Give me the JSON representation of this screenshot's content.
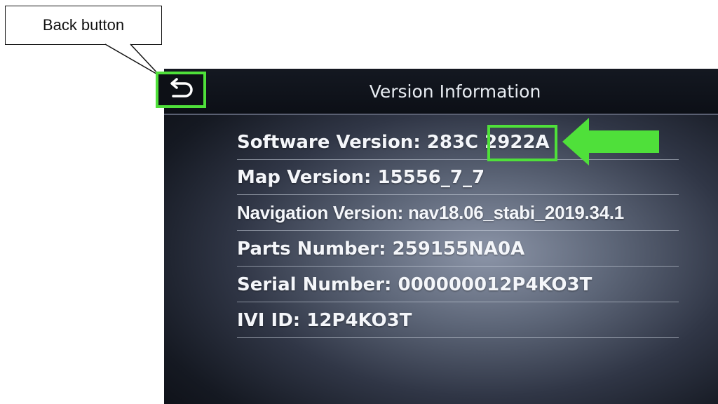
{
  "callout": {
    "label": "Back button"
  },
  "screen": {
    "title": "Version Information",
    "rows": [
      {
        "label": "Software Version: 283C 2922A"
      },
      {
        "label": "Map Version: 15556_7_7"
      },
      {
        "label": "Navigation Version: nav18.06_stabi_2019.34.1"
      },
      {
        "label": "Parts Number: 259155NA0A"
      },
      {
        "label": "Serial Number: 000000012P4KO3T"
      },
      {
        "label": "IVI ID: 12P4KO3T"
      }
    ]
  },
  "colors": {
    "highlight": "#4fe03a",
    "text": "#f4f6fa"
  },
  "icons": {
    "back": "back-arrow-icon",
    "pointer": "left-arrow-icon"
  }
}
